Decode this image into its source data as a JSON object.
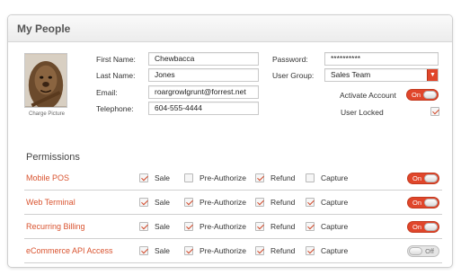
{
  "panel": {
    "title": "My People"
  },
  "profile": {
    "photo_caption": "Charge Picture",
    "first_name": {
      "label": "First Name:",
      "value": "Chewbacca"
    },
    "last_name": {
      "label": "Last Name:",
      "value": "Jones"
    },
    "email": {
      "label": "Email:",
      "value": "roargrowlgrunt@forrest.net"
    },
    "telephone": {
      "label": "Telephone:",
      "value": "604-555-4444"
    },
    "password": {
      "label": "Password:",
      "value": "**********"
    },
    "user_group": {
      "label": "User Group:",
      "value": "Sales Team",
      "button_icon": "caret-down-icon"
    },
    "activate_account": {
      "label": "Activate Account",
      "state": "On"
    },
    "user_locked": {
      "label": "User Locked",
      "checked": true
    }
  },
  "permissions": {
    "title": "Permissions",
    "option_labels": [
      "Sale",
      "Pre-Authorize",
      "Refund",
      "Capture"
    ],
    "rows": [
      {
        "name": "Mobile POS",
        "checks": [
          true,
          false,
          true,
          false
        ],
        "toggle": "On"
      },
      {
        "name": "Web Terminal",
        "checks": [
          true,
          true,
          true,
          true
        ],
        "toggle": "On"
      },
      {
        "name": "Recurring Billing",
        "checks": [
          true,
          true,
          true,
          true
        ],
        "toggle": "On"
      },
      {
        "name": "eCommerce API Access",
        "checks": [
          true,
          true,
          true,
          true
        ],
        "toggle": "Off"
      }
    ]
  },
  "colors": {
    "accent": "#e0462b",
    "permission_name": "#d9532f"
  }
}
